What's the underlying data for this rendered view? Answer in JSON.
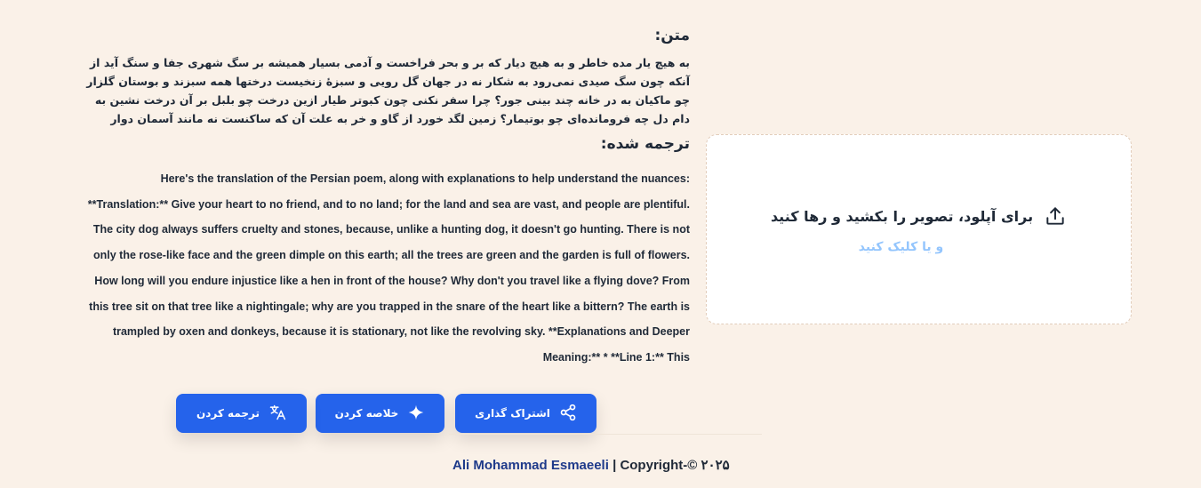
{
  "text_section": {
    "title": "متن:",
    "poem": "به هیچ یار مده خاطر و به هیچ دیار که بر و بحر فراخست و آدمی بسیار همیشه بر سگ شهری جفا و سنگ آید از آنکه چون سگ صیدی نمی‌رود به شکار نه در جهان گل رویی و سبزهٔ زنخیست درختها همه سبزند و بوستان گلزار چو ماکیان به در خانه چند بینی جور؟ چرا سفر نکنی چون کبوتر طیار ازین درخت چو بلبل بر آن درخت نشین به دام دل چه فرومانده‌ای چو بوتیمار؟ زمین لگد خورد از گاو و خر به علت آن که ساکنست نه مانند آسمان دوار"
  },
  "translation_section": {
    "title": "ترجمه شده:",
    "text": "Here's the translation of the Persian poem, along with explanations to help understand the nuances: **Translation:** Give your heart to no friend, and to no land; for the land and sea are vast, and people are plentiful. The city dog always suffers cruelty and stones, because, unlike a hunting dog, it doesn't go hunting. There is not only the rose-like face and the green dimple on this earth; all the trees are green and the garden is full of flowers. How long will you endure injustice like a hen in front of the house? Why don't you travel like a flying dove? From this tree sit on that tree like a nightingale; why are you trapped in the snare of the heart like a bittern? The earth is trampled by oxen and donkeys, because it is stationary, not like the revolving sky. **Explanations and Deeper Meaning:** * **Line 1:** This"
  },
  "upload": {
    "title": "برای آپلود، تصویر را بکشید و رها کنید",
    "subtitle": "و یا کلیک کنید",
    "icon": "upload-icon"
  },
  "actions": {
    "share_label": "اشتراک گذاری",
    "summarize_label": "خلاصه کردن",
    "translate_label": "ترجمه کردن"
  },
  "footer": {
    "author": "Ali Mohammad Esmaeeli",
    "copyright": " | Copyright-© ۲۰۲۵"
  },
  "colors": {
    "background": "#faf1e8",
    "primary_button": "#2563eb",
    "upload_subtitle": "#93c5fd",
    "author_link": "#1e3a8a"
  }
}
